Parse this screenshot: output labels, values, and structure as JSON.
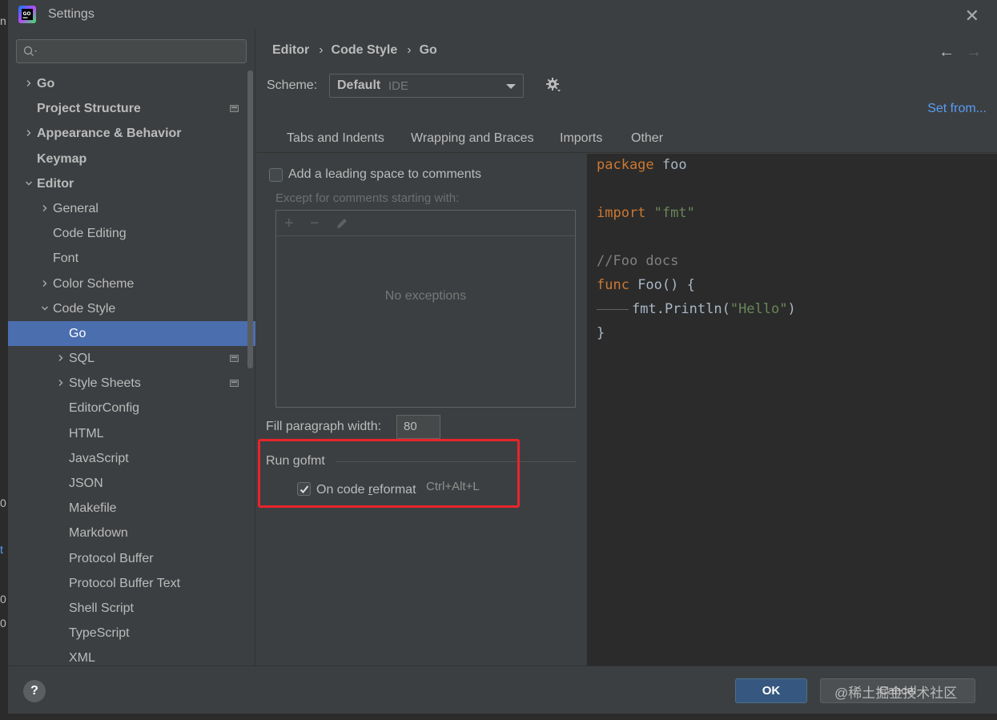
{
  "window": {
    "title": "Settings",
    "app_icon": "goland-icon",
    "close_icon": "close-icon"
  },
  "sidebar": {
    "search": {
      "placeholder": "",
      "icon": "search-icon"
    },
    "items": [
      {
        "label": "Go",
        "level": 0,
        "arrow": "right",
        "bold": true
      },
      {
        "label": "Project Structure",
        "level": 0,
        "arrow": "none",
        "bold": true,
        "project_icon": true
      },
      {
        "label": "Appearance & Behavior",
        "level": 0,
        "arrow": "right",
        "bold": true
      },
      {
        "label": "Keymap",
        "level": 0,
        "arrow": "none",
        "bold": true
      },
      {
        "label": "Editor",
        "level": 0,
        "arrow": "down",
        "bold": true
      },
      {
        "label": "General",
        "level": 1,
        "arrow": "right"
      },
      {
        "label": "Code Editing",
        "level": 1,
        "arrow": "none"
      },
      {
        "label": "Font",
        "level": 1,
        "arrow": "none"
      },
      {
        "label": "Color Scheme",
        "level": 1,
        "arrow": "right"
      },
      {
        "label": "Code Style",
        "level": 1,
        "arrow": "down"
      },
      {
        "label": "Go",
        "level": 2,
        "arrow": "none",
        "selected": true
      },
      {
        "label": "SQL",
        "level": 2,
        "arrow": "right",
        "project_icon": true
      },
      {
        "label": "Style Sheets",
        "level": 2,
        "arrow": "right",
        "project_icon": true
      },
      {
        "label": "EditorConfig",
        "level": 2,
        "arrow": "none"
      },
      {
        "label": "HTML",
        "level": 2,
        "arrow": "none"
      },
      {
        "label": "JavaScript",
        "level": 2,
        "arrow": "none"
      },
      {
        "label": "JSON",
        "level": 2,
        "arrow": "none"
      },
      {
        "label": "Makefile",
        "level": 2,
        "arrow": "none"
      },
      {
        "label": "Markdown",
        "level": 2,
        "arrow": "none"
      },
      {
        "label": "Protocol Buffer",
        "level": 2,
        "arrow": "none"
      },
      {
        "label": "Protocol Buffer Text",
        "level": 2,
        "arrow": "none"
      },
      {
        "label": "Shell Script",
        "level": 2,
        "arrow": "none"
      },
      {
        "label": "TypeScript",
        "level": 2,
        "arrow": "none"
      },
      {
        "label": "XML",
        "level": 2,
        "arrow": "none"
      }
    ]
  },
  "breadcrumb": [
    "Editor",
    "Code Style",
    "Go"
  ],
  "nav": {
    "back_icon": "arrow-left-icon",
    "forward_icon": "arrow-right-icon"
  },
  "scheme": {
    "label": "Scheme:",
    "value": "Default",
    "sub": "IDE",
    "gear_icon": "gear-icon",
    "set_from": "Set from..."
  },
  "tabs": [
    {
      "label": "Tabs and Indents",
      "active": false
    },
    {
      "label": "Wrapping and Braces",
      "active": false
    },
    {
      "label": "Imports",
      "active": false
    },
    {
      "label": "Other",
      "active": true
    }
  ],
  "other": {
    "leading_space_label": "Add a leading space to comments",
    "leading_space_checked": false,
    "except_label": "Except for comments starting with:",
    "add_icon": "+",
    "remove_icon": "−",
    "edit_icon": "pencil-icon",
    "no_exceptions": "No exceptions",
    "fill_label": "Fill paragraph width:",
    "fill_value": "80",
    "gofmt_title": "Run gofmt",
    "gofmt_on_reformat_prefix": "On code ",
    "gofmt_on_reformat_underlined": "r",
    "gofmt_on_reformat_suffix": "eformat",
    "gofmt_checked": true,
    "gofmt_shortcut": "Ctrl+Alt+L"
  },
  "preview": {
    "lines": [
      [
        {
          "t": "package",
          "c": "kw"
        },
        {
          "t": " foo",
          "c": "id"
        }
      ],
      [],
      [
        {
          "t": "import",
          "c": "kw"
        },
        {
          "t": " ",
          "c": "id"
        },
        {
          "t": "\"fmt\"",
          "c": "str"
        }
      ],
      [],
      [
        {
          "t": "//Foo docs",
          "c": "cmt"
        }
      ],
      [
        {
          "t": "func",
          "c": "kw"
        },
        {
          "t": " Foo() {",
          "c": "id"
        }
      ],
      [
        {
          "t": "TAB",
          "c": "tab"
        },
        {
          "t": "fmt.Println(",
          "c": "id"
        },
        {
          "t": "\"Hello\"",
          "c": "str"
        },
        {
          "t": ")",
          "c": "id"
        }
      ],
      [
        {
          "t": "}",
          "c": "id"
        }
      ]
    ]
  },
  "footer": {
    "help": "?",
    "ok": "OK",
    "cancel": "Cancel",
    "watermark": "@稀土掘金技术社区"
  },
  "background_fragments": [
    "n",
    "0",
    "t",
    "0",
    "0"
  ],
  "colors": {
    "selection": "#4b6eaf",
    "link": "#589df6",
    "highlight_box": "#e8242b",
    "keyword": "#cc7832",
    "string": "#6a8759",
    "comment": "#808080"
  }
}
